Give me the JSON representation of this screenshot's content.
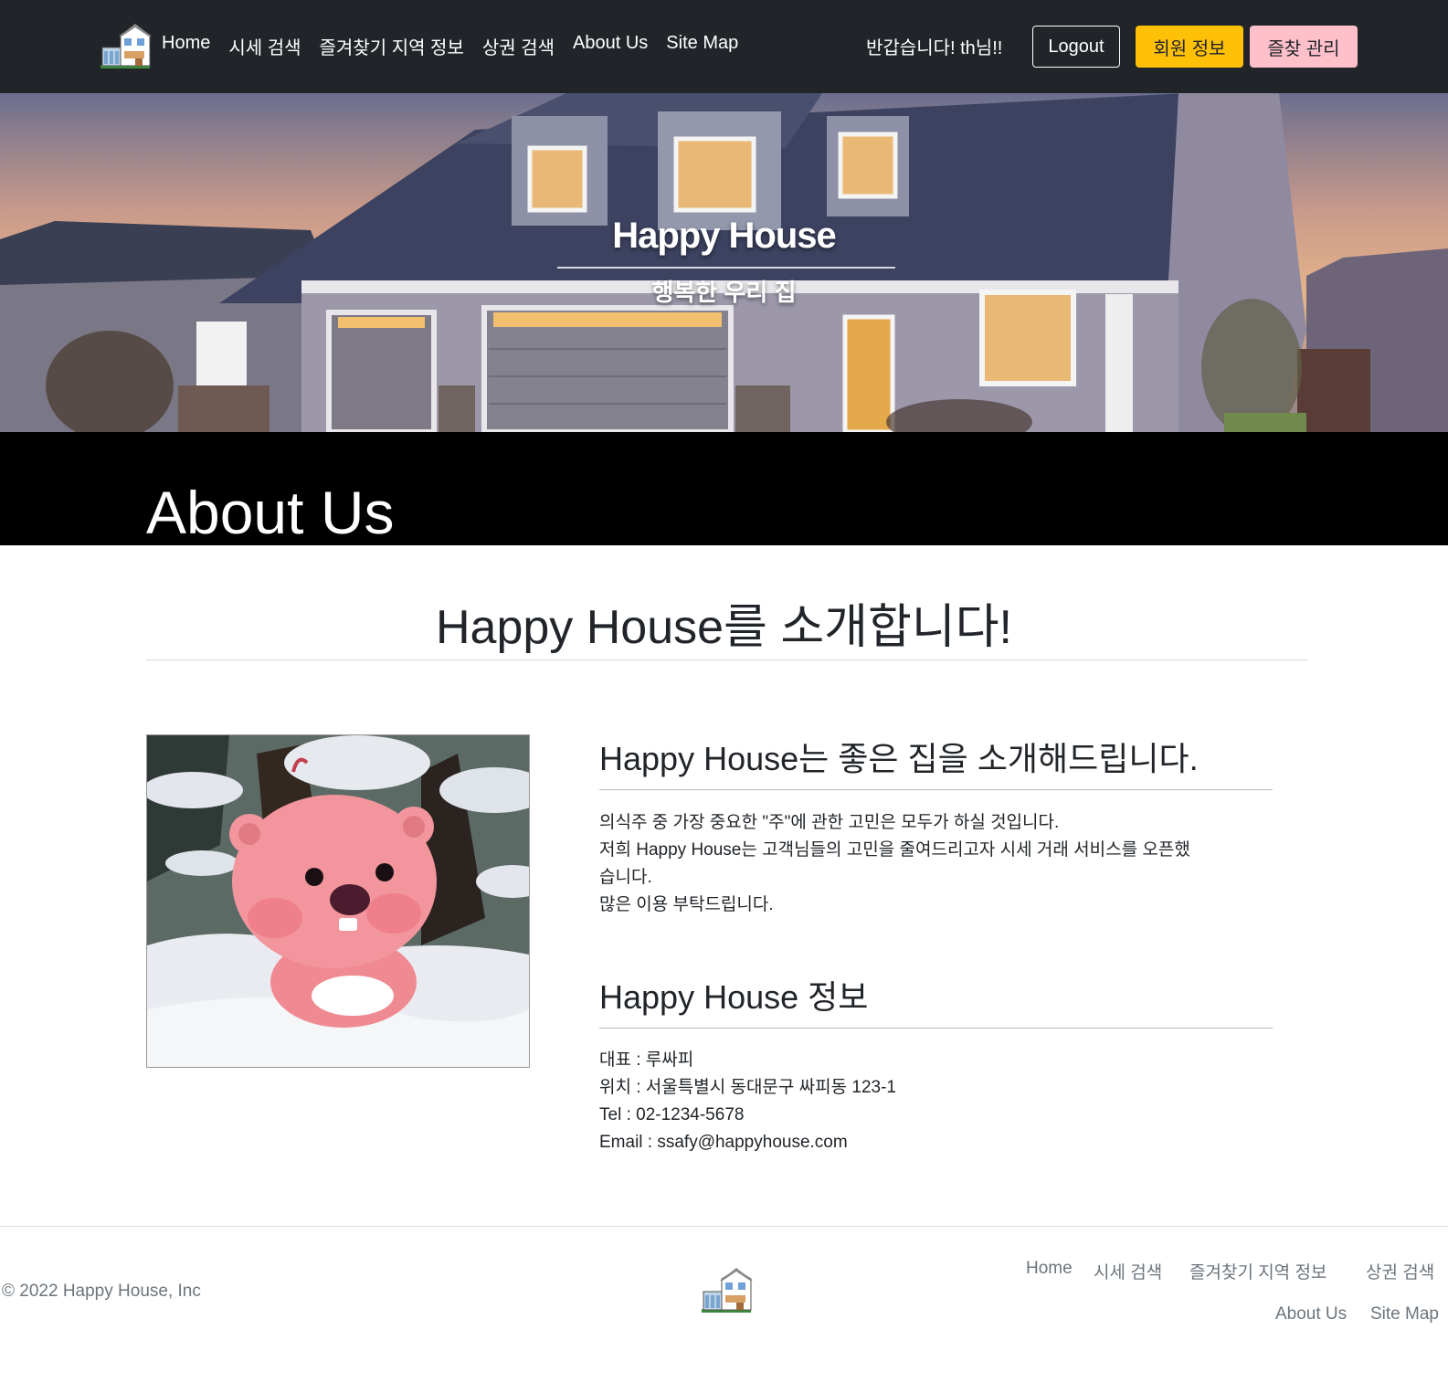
{
  "navbar": {
    "links": [
      "Home",
      "시세 검색",
      "즐겨찾기 지역 정보",
      "상권 검색",
      "About Us",
      "Site Map"
    ],
    "greeting": "반갑습니다! th님!!",
    "logout_label": "Logout",
    "member_label": "회원 정보",
    "favorites_label": "즐찾 관리",
    "colors": {
      "background": "#212529",
      "member_button": "#ffc107",
      "favorites_button": "#ffc0cb"
    }
  },
  "hero": {
    "title": "Happy House",
    "subtitle": "행복한 우리 집"
  },
  "page_title": "About Us",
  "intro": {
    "heading": "Happy House를 소개합니다!"
  },
  "image": {
    "icon": "pink-beaver-character-image"
  },
  "about": {
    "heading": "Happy House는 좋은 집을 소개해드립니다.",
    "lines": [
      "의식주 중 가장 중요한 \"주\"에 관한 고민은 모두가 하실 것입니다.",
      "저희 Happy House는 고객님들의 고민을 줄여드리고자 시세 거래 서비스를 오픈했",
      "습니다.",
      "많은 이용 부탁드립니다."
    ]
  },
  "info": {
    "heading": "Happy House 정보",
    "lines": [
      "대표 : 루싸피",
      "위치 : 서울특별시 동대문구 싸피동 123-1",
      "Tel : 02-1234-5678",
      "Email : ssafy@happyhouse.com"
    ]
  },
  "footer": {
    "copyright": "© 2022 Happy House, Inc",
    "links_row1": [
      "Home",
      "시세 검색",
      "즐겨찾기 지역 정보",
      "상권 검색"
    ],
    "links_row2": [
      "About Us",
      "Site Map"
    ]
  }
}
